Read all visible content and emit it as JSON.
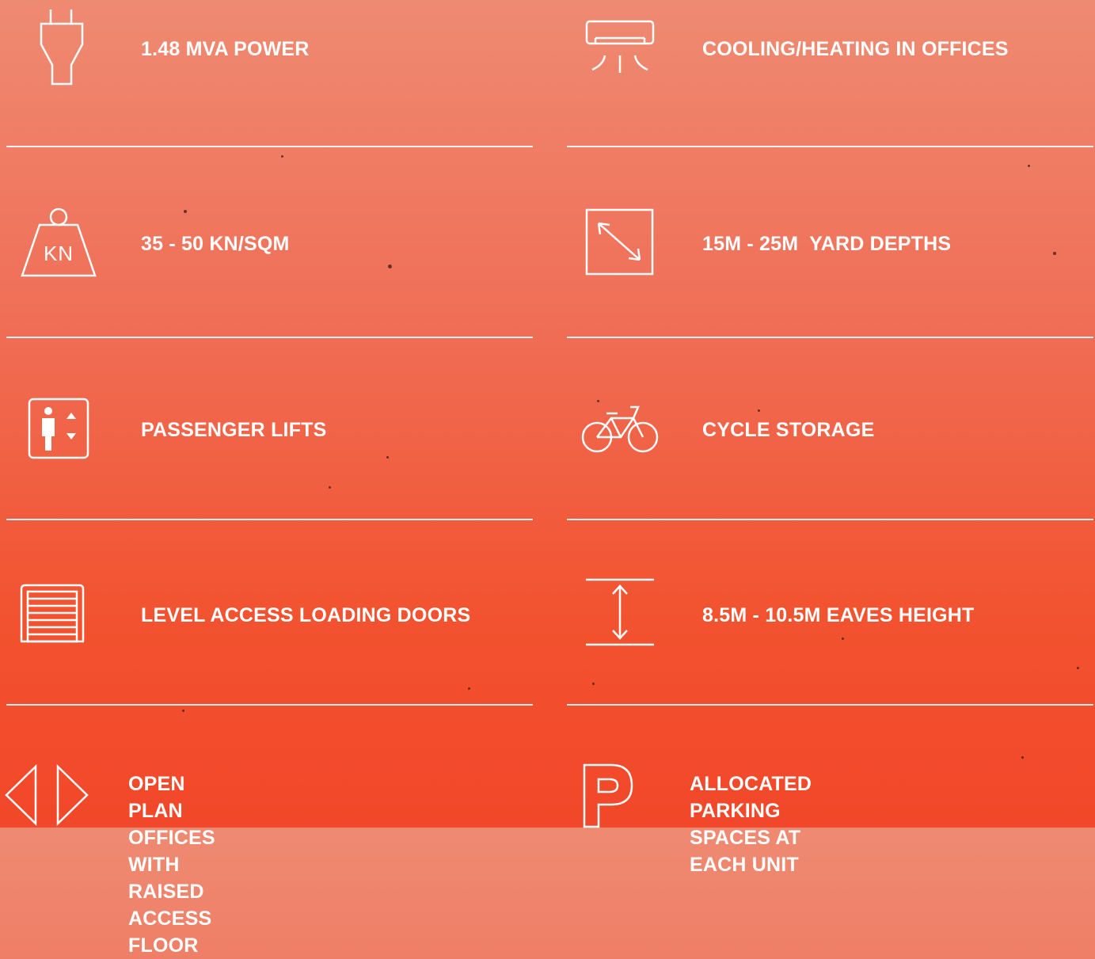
{
  "colors": {
    "background_top": "#ef8a72",
    "background_bottom": "#f2472a",
    "foreground": "#ffffff"
  },
  "features": [
    {
      "id": "power",
      "icon": "plug-icon",
      "label": "1.48 MVA POWER"
    },
    {
      "id": "cooling",
      "icon": "air-conditioner-icon",
      "label": "COOLING/HEATING IN OFFICES"
    },
    {
      "id": "floor-load",
      "icon": "weight-icon",
      "label": "35 - 50 KN/SQM",
      "icon_text": "KN"
    },
    {
      "id": "yard",
      "icon": "diagonal-arrow-icon",
      "label": "15M - 25M  YARD DEPTHS"
    },
    {
      "id": "lifts",
      "icon": "elevator-icon",
      "label": "PASSENGER LIFTS"
    },
    {
      "id": "cycle",
      "icon": "bicycle-icon",
      "label": "CYCLE STORAGE"
    },
    {
      "id": "doors",
      "icon": "roller-door-icon",
      "label": "LEVEL ACCESS LOADING DOORS"
    },
    {
      "id": "eaves",
      "icon": "vertical-height-icon",
      "label": "8.5M - 10.5M EAVES HEIGHT"
    },
    {
      "id": "offices",
      "icon": "open-plan-arrows-icon",
      "label_lines": [
        "OPEN PLAN OFFICES WITH",
        "RAISED ACCESS FLOOR"
      ]
    },
    {
      "id": "parking",
      "icon": "parking-icon",
      "label_lines": [
        "ALLOCATED PARKING SPACES AT",
        "EACH UNIT"
      ]
    }
  ]
}
